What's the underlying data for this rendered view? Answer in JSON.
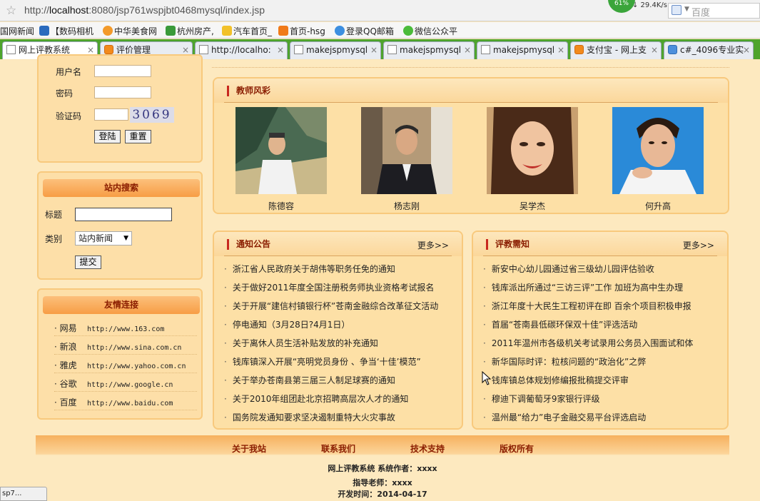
{
  "browser": {
    "url_prefix": "http://",
    "url_host": "localhost",
    "url_rest": ":8080/jsp761wspjbt0468mysql/index.jsp",
    "speed_badge": "61%",
    "speed_rate": "↓ 29.4K/s",
    "search_placeholder": "百度",
    "bookmarks": [
      "国网新闻",
      "【数码相机",
      "中华美食网",
      "杭州房产,",
      "汽车首页_",
      "首页-hsg",
      "登录QQ邮箱",
      "微信公众平"
    ],
    "tabs": [
      {
        "label": "网上评教系统"
      },
      {
        "label": "评价管理"
      },
      {
        "label": "http://localho:"
      },
      {
        "label": "makejspmysql"
      },
      {
        "label": "makejspmysql"
      },
      {
        "label": "makejspmysql"
      },
      {
        "label": "支付宝 - 网上支"
      },
      {
        "label": "c#_4096专业实"
      }
    ],
    "tab_close": "×",
    "status_tip": "sp7..."
  },
  "login": {
    "username_label": "用户名",
    "password_label": "密码",
    "captcha_label": "验证码",
    "captcha_code": "3069",
    "login_button": "登陆",
    "reset_button": "重置"
  },
  "site_search": {
    "heading": "站内搜索",
    "title_label": "标题",
    "category_label": "类别",
    "category_selected": "站内新闻",
    "submit_button": "提交"
  },
  "friend_links": {
    "heading": "友情连接",
    "items": [
      {
        "name": "网易",
        "url": "http://www.163.com"
      },
      {
        "name": "新浪",
        "url": "http://www.sina.com.cn"
      },
      {
        "name": "雅虎",
        "url": "http://www.yahoo.com.cn"
      },
      {
        "name": "谷歌",
        "url": "http://www.google.cn"
      },
      {
        "name": "百度",
        "url": "http://www.baidu.com"
      }
    ]
  },
  "teachers": {
    "heading": "教师风彩",
    "items": [
      {
        "name": "陈德容"
      },
      {
        "name": "杨志刚"
      },
      {
        "name": "吴学杰"
      },
      {
        "name": "何升高"
      }
    ]
  },
  "notices": {
    "heading": "通知公告",
    "more": "更多>>",
    "items": [
      "浙江省人民政府关于胡伟等职务任免的通知",
      "关于做好2011年度全国注册税务师执业资格考试报名",
      "关于开展“建信村镇银行杯”苍南金融综合改革征文活动",
      "停电通知（3月28日?4月1日）",
      "关于离休人员生活补贴发放的补充通知",
      "钱库镇深入开展“亮明党员身份 、争当‘十佳’模范”",
      "关于举办苍南县第三届三人制足球赛的通知",
      "关于2010年组团赴北京招聘高层次人才的通知",
      "国务院发通知要求坚决遏制重特大火灾事故"
    ]
  },
  "reviews": {
    "heading": "评教需知",
    "more": "更多>>",
    "items": [
      "新安中心幼儿园通过省三级幼儿园评估验收",
      "钱库派出所通过“三访三评”工作 加班为高中生办理",
      "浙江年度十大民生工程初评在即 百余个项目积极申报",
      "首届“苍南县低碳环保双十佳”评选活动",
      "2011年温州市各级机关考试录用公务员入围面试和体",
      "新华国际时评：粒核问题的“政治化”之弊",
      "钱库镇总体规划修编报批稿提交评审",
      "穆迪下调葡萄牙9家银行评级",
      "温州最“给力”电子金融交易平台评选启动"
    ]
  },
  "footer": {
    "links": [
      "关于我站",
      "联系我们",
      "技术支持",
      "版权所有"
    ],
    "system_line": "网上评教系统  系统作者：xxxx",
    "advisor_line": "指导老师：xxxx",
    "date_line": "开发时间：2014-04-17"
  }
}
